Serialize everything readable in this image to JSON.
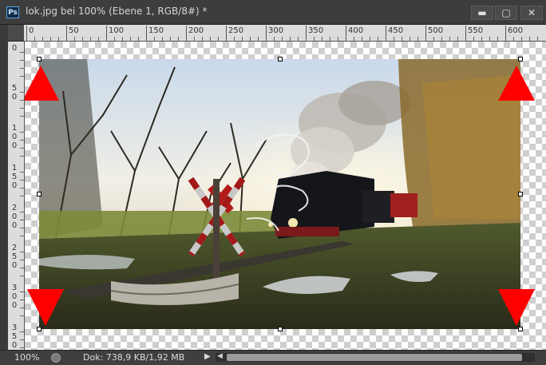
{
  "window": {
    "app_icon_text": "Ps",
    "title": "lok.jpg bei 100% (Ebene 1, RGB/8#) *",
    "btn_minimize": "▬",
    "btn_maximize": "▢",
    "btn_close": "✕"
  },
  "ruler": {
    "h_labels": [
      "0",
      "50",
      "100",
      "150",
      "200",
      "250",
      "300",
      "350",
      "400",
      "450",
      "500",
      "550",
      "600"
    ],
    "v_labels": [
      [
        "0"
      ],
      [
        "5",
        "0"
      ],
      [
        "1",
        "0",
        "0"
      ],
      [
        "1",
        "5",
        "0"
      ],
      [
        "2",
        "0",
        "0"
      ],
      [
        "2",
        "5",
        "0"
      ],
      [
        "3",
        "0",
        "0"
      ],
      [
        "3",
        "5",
        "0"
      ]
    ]
  },
  "status": {
    "zoom": "100%",
    "doc_info": "Dok: 738,9 KB/1,92 MB",
    "arrow": "▶",
    "scroll_left": "◀"
  },
  "colors": {
    "arrow_red": "#ff0000",
    "ui_dark": "#3d3d3d"
  },
  "icons": [
    "photoshop-icon",
    "minimize-icon",
    "maximize-icon",
    "close-icon",
    "arrow-up-icon",
    "arrow-down-icon"
  ]
}
